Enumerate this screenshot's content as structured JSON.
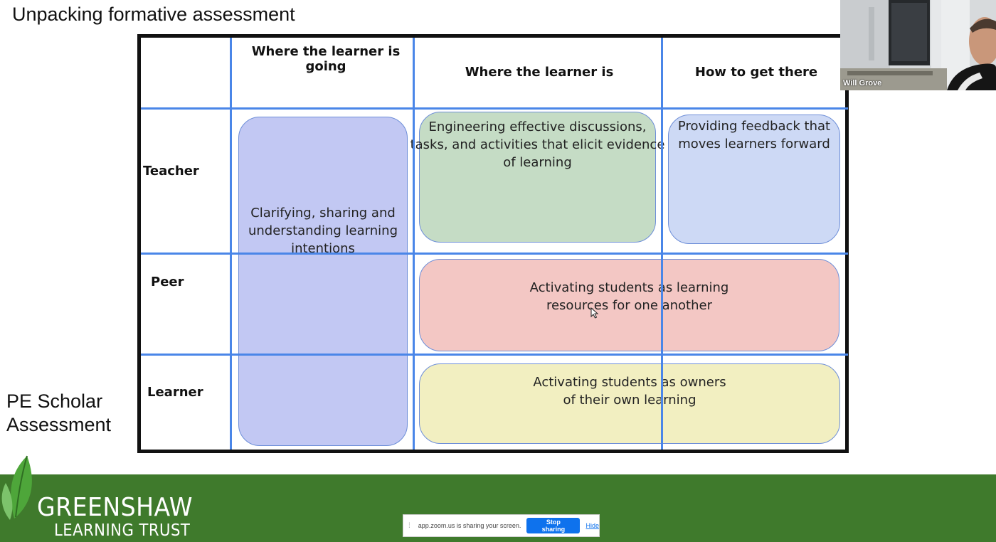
{
  "slide": {
    "title": "Unpacking formative assessment",
    "side_label_line1": "PE Scholar",
    "side_label_line2": "Assessment"
  },
  "table": {
    "columns": [
      "Where the learner is going",
      "Where the learner is",
      "How to get there"
    ],
    "rows": [
      "Teacher",
      "Peer",
      "Learner"
    ],
    "cells": {
      "clarifying": [
        "Clarifying, sharing and",
        "understanding learning",
        "intentions"
      ],
      "engineering": [
        "Engineering effective discussions,",
        "tasks, and activities that elicit evidence",
        "of learning"
      ],
      "feedback": [
        "Providing feedback that",
        "moves learners forward"
      ],
      "peer": [
        "Activating students as learning",
        "resources for one another"
      ],
      "owners": [
        "Activating students as owners",
        "of their own learning"
      ]
    },
    "colors": {
      "grid_line": "#4a86e8",
      "clarifying": "#c2c8f3",
      "engineering": "#c5dcc5",
      "feedback": "#cdd9f5",
      "peer": "#f3c7c4",
      "owners": "#f2efc1"
    }
  },
  "webcam": {
    "participant_name": "Will Grove"
  },
  "footer": {
    "brand_line1": "GREENSHAW",
    "brand_line2": "LEARNING TRUST",
    "brand_color": "#3f7a2c"
  },
  "share_bar": {
    "grip_icon": "drag-handle-icon",
    "message": "app.zoom.us is sharing your screen.",
    "stop_label": "Stop sharing",
    "hide_label": "Hide"
  }
}
